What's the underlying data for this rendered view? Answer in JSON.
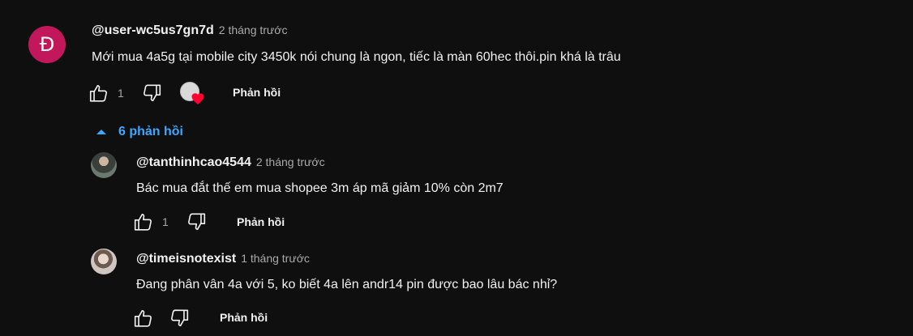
{
  "comment": {
    "avatar_letter": "Đ",
    "author": "@user-wc5us7gn7d",
    "time": "2 tháng trước",
    "text": "Mới mua 4a5g tại mobile city  3450k nói chung là ngon, tiếc là màn 60hec  thôi.pin khá là trâu",
    "likes": "1",
    "reply_label": "Phản hồi",
    "replies_toggle_label": "6 phản hồi"
  },
  "replies": [
    {
      "author": "@tanthinhcao4544",
      "time": "2 tháng trước",
      "text": "Bác mua đắt thế em mua shopee 3m áp mã giảm 10% còn 2m7",
      "likes": "1",
      "reply_label": "Phản hồi"
    },
    {
      "author": "@timeisnotexist",
      "time": "1 tháng trước",
      "text": "Đang phân vân 4a với 5, ko biết 4a lên andr14 pin được bao lâu bác nhỉ?",
      "reply_label": "Phản hồi"
    }
  ],
  "icons": {
    "like": "thumbs-up-icon",
    "dislike": "thumbs-down-icon",
    "creator_heart": "heart-icon",
    "toggle": "caret-up-icon"
  },
  "colors": {
    "background": "#0f0f0f",
    "accent": "#3ea6ff",
    "heart": "#ff0033",
    "avatar_main": "#c2185b"
  }
}
